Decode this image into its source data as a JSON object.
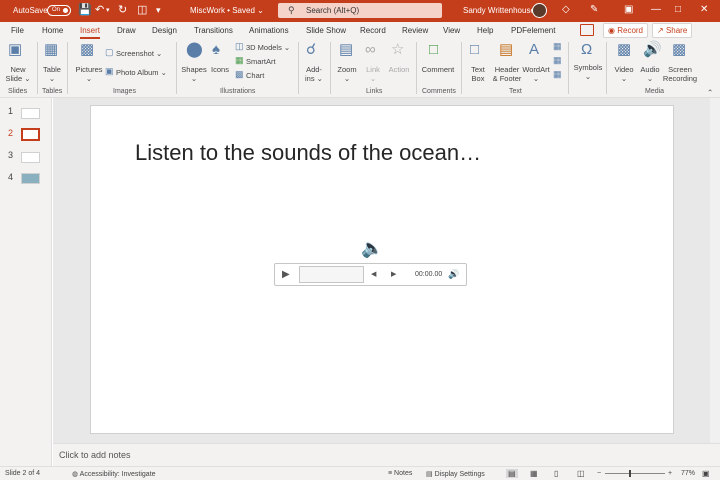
{
  "titlebar": {
    "autosave_label": "AutoSave",
    "autosave_state": "On",
    "doc_title": "MiscWork • Saved ⌄",
    "search_placeholder": "Search (Alt+Q)",
    "user_name": "Sandy Writtenhouse",
    "window_controls": [
      "minimize",
      "restore",
      "close"
    ],
    "bg_color": "#c43e1c"
  },
  "menu": {
    "tabs": [
      "File",
      "Home",
      "Insert",
      "Draw",
      "Design",
      "Transitions",
      "Animations",
      "Slide Show",
      "Record",
      "Review",
      "View",
      "Help",
      "PDFelement"
    ],
    "active_tab": "Insert",
    "record_label": "Record",
    "share_label": "Share"
  },
  "ribbon": {
    "slides": {
      "new_slide": "New\nSlide ⌄",
      "group": "Slides"
    },
    "tables": {
      "table": "Table\n⌄",
      "group": "Tables"
    },
    "images": {
      "pictures": "Pictures\n⌄",
      "screenshot": "Screenshot ⌄",
      "photo_album": "Photo Album ⌄",
      "group": "Images"
    },
    "illustrations": {
      "shapes": "Shapes\n⌄",
      "icons": "Icons",
      "models_3d": "3D Models ⌄",
      "smartart": "SmartArt",
      "chart": "Chart",
      "group": "Illustrations"
    },
    "addins": {
      "addins": "Add-\nins ⌄"
    },
    "links": {
      "zoom": "Zoom\n⌄",
      "link": "Link\n⌄",
      "action": "Action",
      "group": "Links"
    },
    "comments": {
      "comment": "Comment",
      "group": "Comments"
    },
    "text": {
      "text_box": "Text\nBox",
      "header_footer": "Header\n& Footer",
      "wordart": "WordArt\n⌄",
      "group": "Text"
    },
    "symbols": {
      "symbols": "Symbols\n⌄"
    },
    "media": {
      "video": "Video\n⌄",
      "audio": "Audio\n⌄",
      "screen_recording": "Screen\nRecording",
      "group": "Media"
    }
  },
  "slides_panel": {
    "numbers": [
      "1",
      "2",
      "3",
      "4"
    ],
    "selected": "2",
    "accent": "#c43e1c"
  },
  "slide": {
    "title": "Listen to the sounds of the ocean…",
    "audio_time": "00:00.00"
  },
  "notes_placeholder": "Click to add notes",
  "status": {
    "slide_info": "Slide 2 of 4",
    "accessibility": "Accessibility: Investigate",
    "notes": "Notes",
    "display_settings": "Display Settings",
    "zoom_level": "77%"
  }
}
